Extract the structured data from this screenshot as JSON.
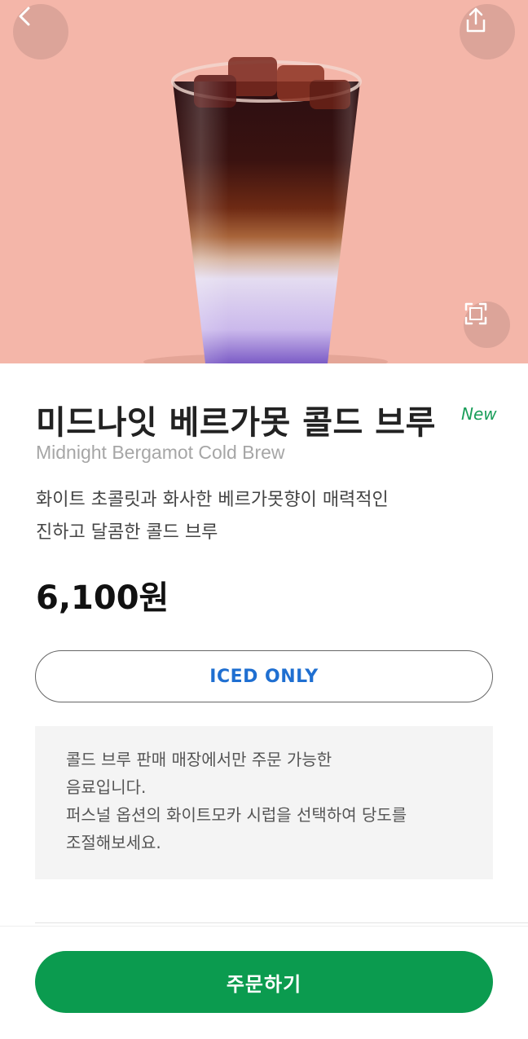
{
  "product": {
    "name_ko": "미드나잇 베르가못 콜드 브루",
    "badge": "New",
    "name_en": "Midnight Bergamot Cold Brew",
    "description_line1": "화이트 초콜릿과 화사한 베르가못향이 매력적인",
    "description_line2": "진하고 달콤한 콜드 브루",
    "price": "6,100원",
    "temperature_option": "ICED ONLY",
    "image_alt": "cold-brew-drink"
  },
  "notice": {
    "line1": "콜드 브루 판매 매장에서만 주문 가능한",
    "line2": "음료입니다.",
    "line3": "퍼스널 옵션의 화이트모카 시럽을 선택하여 당도를",
    "line4": "조절해보세요."
  },
  "actions": {
    "order_label": "주문하기"
  },
  "colors": {
    "hero_bg": "#f4b6a9",
    "brand_green": "#0b9b4f",
    "badge_green": "#1a9e5a",
    "iced_blue": "#1f6fd1"
  }
}
